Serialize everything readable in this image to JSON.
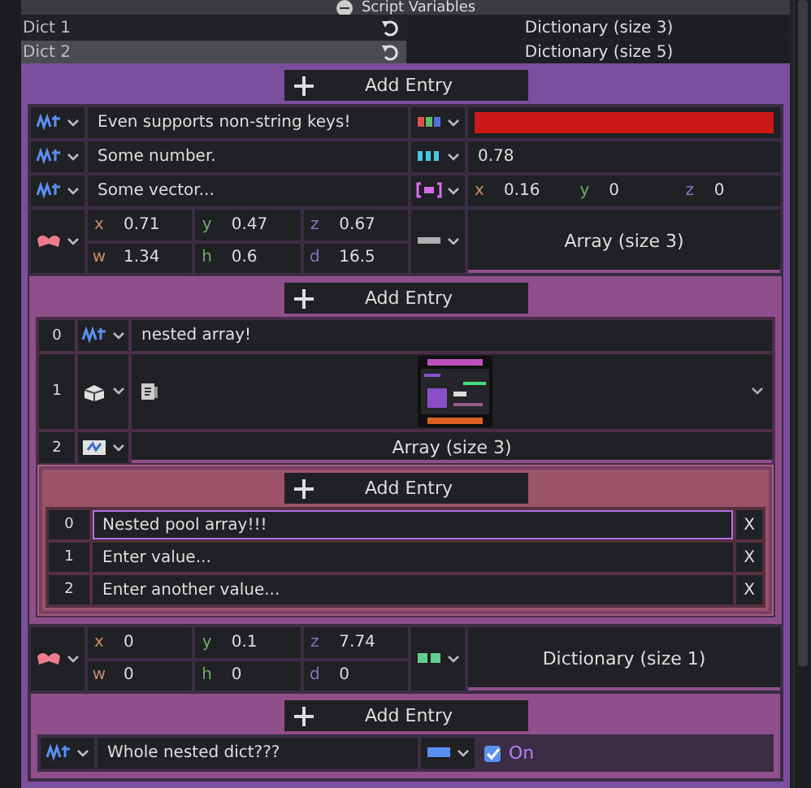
{
  "header": {
    "title": "Script Variables"
  },
  "properties": [
    {
      "label": "Dict 1",
      "selected": false,
      "value": "Dictionary (size 3)"
    },
    {
      "label": "Dict 2",
      "selected": true,
      "value": "Dictionary (size 5)"
    }
  ],
  "dictionary": {
    "kind": "dictionary",
    "add_button": "Add Entry",
    "entries": [
      {
        "key": {
          "kind": "string",
          "text": "Even supports non-string keys!"
        },
        "value": {
          "kind": "color",
          "color": "#cc1818"
        }
      },
      {
        "key": {
          "kind": "string",
          "text": "Some number."
        },
        "value": {
          "kind": "float",
          "text": "0.78"
        }
      },
      {
        "key": {
          "kind": "string",
          "text": "Some vector..."
        },
        "value": {
          "kind": "vector3",
          "components": [
            {
              "axis": "x",
              "value": "0.16"
            },
            {
              "axis": "y",
              "value": "0"
            },
            {
              "axis": "z",
              "value": "0"
            }
          ]
        }
      },
      {
        "key": {
          "kind": "aabb",
          "components": [
            {
              "axis": "x",
              "value": "0.71"
            },
            {
              "axis": "y",
              "value": "0.47"
            },
            {
              "axis": "z",
              "value": "0.67"
            },
            {
              "axis": "w",
              "value": "1.34"
            },
            {
              "axis": "h",
              "value": "0.6"
            },
            {
              "axis": "d",
              "value": "16.5"
            }
          ]
        },
        "value": {
          "kind": "array",
          "label": "Array (size 3)",
          "nested": {
            "kind": "array",
            "add_button": "Add Entry",
            "items": [
              {
                "index": "0",
                "value": {
                  "kind": "string",
                  "text": "nested array!"
                }
              },
              {
                "index": "1",
                "value": {
                  "kind": "object"
                }
              },
              {
                "index": "2",
                "value": {
                  "kind": "packed_array",
                  "label": "Array (size 3)",
                  "nested": {
                    "kind": "string_array",
                    "add_button": "Add Entry",
                    "items": [
                      {
                        "index": "0",
                        "text": "Nested pool array!!!",
                        "focused": true,
                        "remove": "X"
                      },
                      {
                        "index": "1",
                        "text": "Enter value...",
                        "focused": false,
                        "remove": "X"
                      },
                      {
                        "index": "2",
                        "text": "Enter another value...",
                        "focused": false,
                        "remove": "X"
                      }
                    ]
                  }
                }
              }
            ]
          }
        }
      },
      {
        "key": {
          "kind": "aabb",
          "components": [
            {
              "axis": "x",
              "value": "0"
            },
            {
              "axis": "y",
              "value": "0.1"
            },
            {
              "axis": "z",
              "value": "7.74"
            },
            {
              "axis": "w",
              "value": "0"
            },
            {
              "axis": "h",
              "value": "0"
            },
            {
              "axis": "d",
              "value": "0"
            }
          ]
        },
        "value": {
          "kind": "dictionary",
          "label": "Dictionary (size 1)",
          "nested": {
            "kind": "dictionary",
            "add_button": "Add Entry",
            "entries": [
              {
                "key": {
                  "kind": "string",
                  "text": "Whole nested dict???"
                },
                "value": {
                  "kind": "bool",
                  "checked": true,
                  "label": "On"
                }
              }
            ]
          }
        }
      }
    ]
  }
}
